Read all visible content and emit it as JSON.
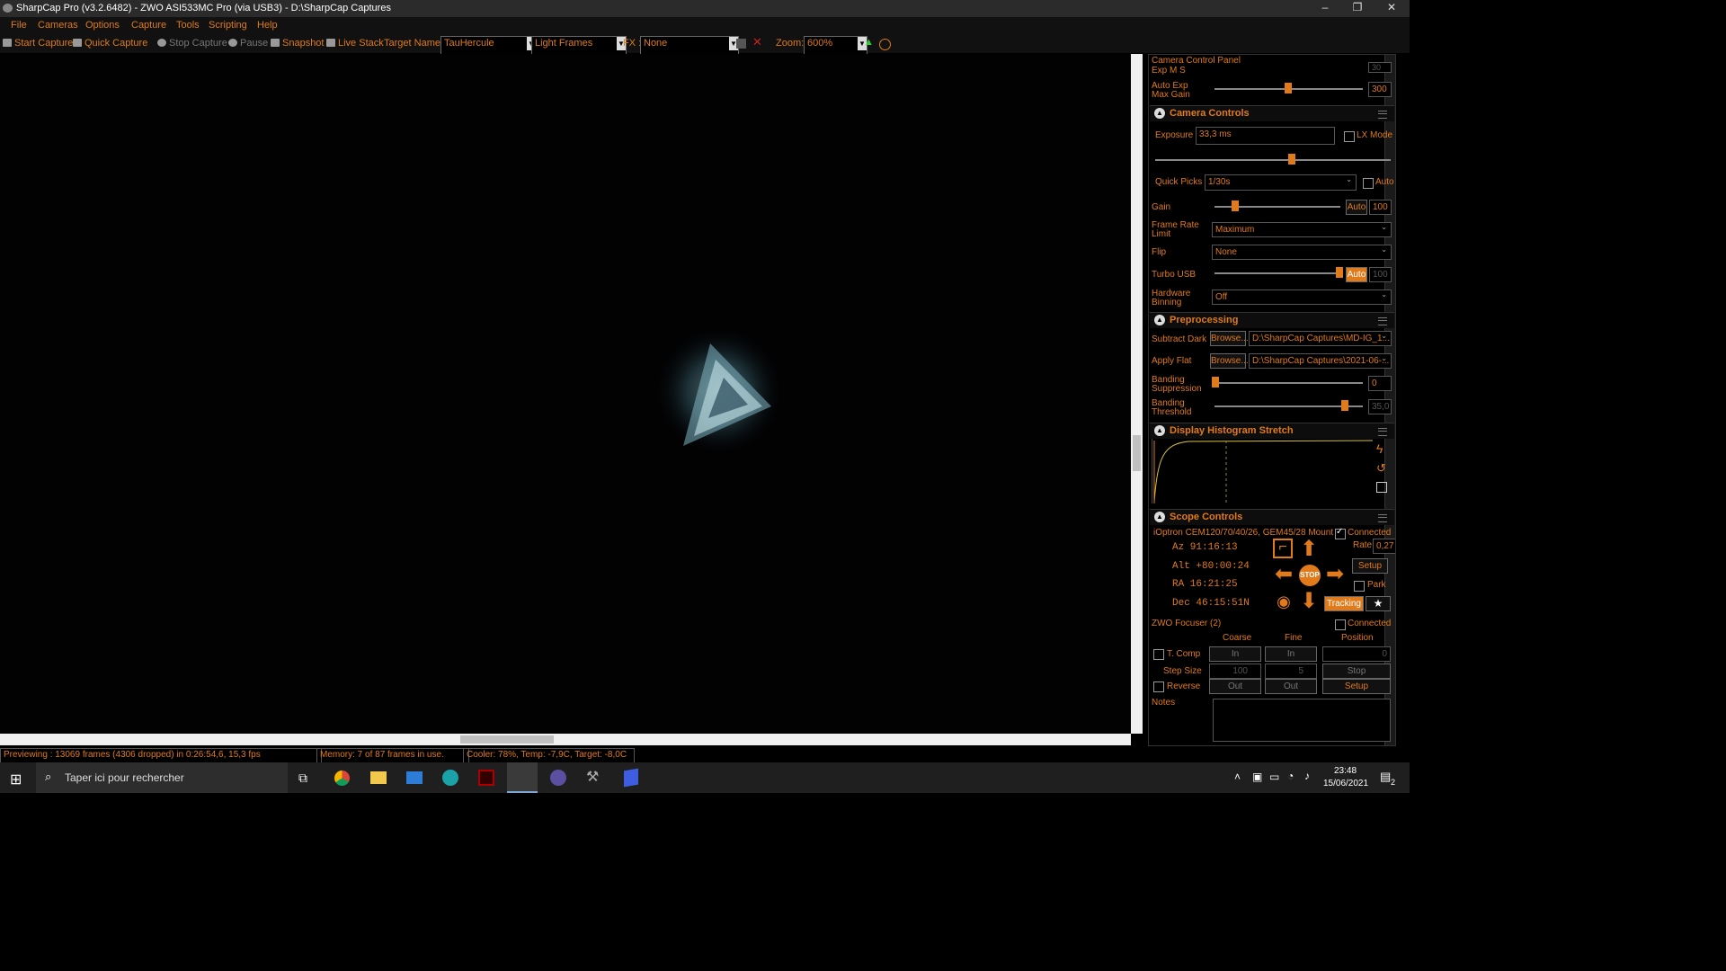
{
  "window": {
    "title": "SharpCap Pro (v3.2.6482) - ZWO ASI533MC Pro (via USB3) - D:\\SharpCap Captures",
    "min": "–",
    "max": "❐",
    "close": "✕"
  },
  "menu": [
    "File",
    "Cameras",
    "Options",
    "Capture",
    "Tools",
    "Scripting",
    "Help"
  ],
  "toolbar": {
    "start_capture": "Start Capture",
    "quick_capture": "Quick Capture",
    "stop_capture": "Stop Capture",
    "pause": "Pause",
    "snapshot": "Snapshot",
    "live_stack": "Live Stack",
    "target_label": "Target Name :",
    "target_value": "TauHercule",
    "frame_type": "Light Frames",
    "fx_label": "FX :",
    "fx_value": "None",
    "zoom_label": "Zoom:",
    "zoom_value": "600%"
  },
  "status": {
    "preview": "Previewing : 13069 frames (4306 dropped) in 0:26:54,6, 15,3 fps",
    "memory": "Memory: 7 of 87 frames in use.",
    "cooler": "Cooler: 78%, Temp: -7,9C, Target: -8,0C"
  },
  "panel": {
    "title": "Camera Control Panel",
    "exp_ms_label": "Exp M S",
    "exp_ms_value": "30",
    "auto_exp_max_gain_label": "Auto Exp Max Gain",
    "auto_exp_max_gain_value": "300",
    "camera_controls": {
      "header": "Camera Controls",
      "exposure_label": "Exposure",
      "exposure_value": "33,3 ms",
      "lx_mode": "LX Mode",
      "quick_picks_label": "Quick Picks",
      "quick_picks_value": "1/30s",
      "auto": "Auto",
      "gain_label": "Gain",
      "gain_value": "100",
      "frame_rate_label": "Frame Rate Limit",
      "frame_rate_value": "Maximum",
      "flip_label": "Flip",
      "flip_value": "None",
      "turbo_label": "Turbo USB",
      "turbo_value": "100",
      "binning_label": "Hardware Binning",
      "binning_value": "Off"
    },
    "preprocessing": {
      "header": "Preprocessing",
      "dark_label": "Subtract Dark",
      "browse": "Browse...",
      "dark_path": "D:\\SharpCap Captures\\MD-IG_1...",
      "flat_label": "Apply Flat",
      "flat_path": "D:\\SharpCap Captures\\2021-06-...",
      "banding_supp_label": "Banding Suppression",
      "banding_supp_value": "0",
      "banding_thr_label": "Banding Threshold",
      "banding_thr_value": "35,0"
    },
    "histogram": {
      "header": "Display Histogram Stretch"
    },
    "scope": {
      "header": "Scope Controls",
      "mount": "iOptron CEM120/70/40/26, GEM45/28 Mount",
      "connected": "Connected",
      "az": "Az  91:16:13",
      "alt": "Alt +80:00:24",
      "ra": "RA  16:21:25",
      "dec": "Dec 46:15:51N",
      "rate_label": "Rate:",
      "rate_value": "0,27",
      "setup": "Setup",
      "park": "Park",
      "tracking": "Tracking",
      "stop": "STOP"
    },
    "focuser": {
      "title": "ZWO Focuser (2)",
      "connected": "Connected",
      "coarse": "Coarse",
      "fine": "Fine",
      "position": "Position",
      "tcomp": "T. Comp",
      "in": "In",
      "position_value": "0",
      "step_size": "Step Size",
      "coarse_step": "100",
      "fine_step": "5",
      "stop": "Stop",
      "reverse": "Reverse",
      "out": "Out",
      "setup": "Setup"
    },
    "notes_label": "Notes"
  },
  "taskbar": {
    "search_placeholder": "Taper ici pour rechercher",
    "time": "23:48",
    "date": "15/06/2021",
    "notif_count": "2"
  }
}
